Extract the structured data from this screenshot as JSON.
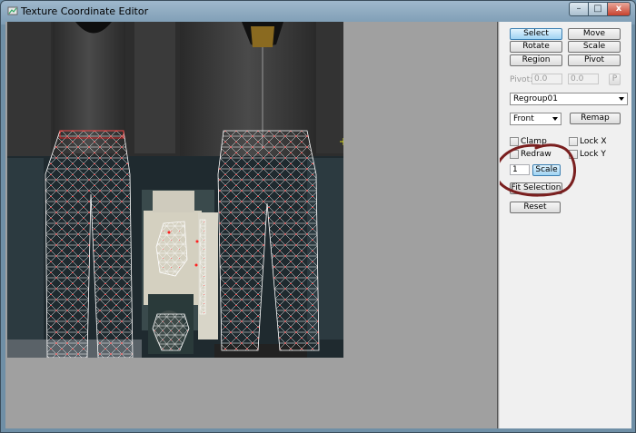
{
  "window": {
    "title": "Texture Coordinate Editor",
    "minimize_glyph": "–",
    "maximize_glyph": "□",
    "close_glyph": "x"
  },
  "panel": {
    "buttons": {
      "select": "Select",
      "move": "Move",
      "rotate": "Rotate",
      "scale": "Scale",
      "region": "Region",
      "pivot": "Pivot"
    },
    "pivot": {
      "label": "Pivot:",
      "x": "0.0",
      "y": "0.0",
      "p_button": "P"
    },
    "group_dropdown": "Regroup01",
    "view_dropdown": "Front",
    "remap_button": "Remap",
    "checkboxes": {
      "clamp": "Clamp",
      "lock_x": "Lock X",
      "redraw": "Redraw",
      "lock_y": "Lock Y"
    },
    "scale_value": "1",
    "scale_button": "Scale",
    "fit_selection_button": "Fit Selection",
    "reset_button": "Reset"
  },
  "colors": {
    "annotation": "#7a1f1f",
    "selected_button": "#9fd3f3",
    "uv_vertex": "#ff2020",
    "uv_edge": "#ffffff"
  },
  "icons": {
    "app": "app-icon",
    "dropdown": "chevron-down-icon"
  }
}
